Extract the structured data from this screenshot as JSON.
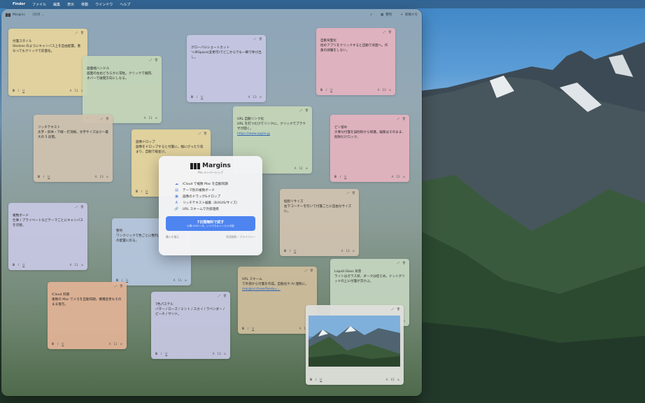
{
  "menubar": {
    "apple": "",
    "app": "Finder",
    "items": [
      "ファイル",
      "編集",
      "表示",
      "移動",
      "ウインドウ",
      "ヘルプ"
    ]
  },
  "window": {
    "brand": "Margins",
    "tag": "1枚目 ⌄",
    "toolbar": {
      "search_icon": "search-icon",
      "view_label": "整列",
      "new_label": "新規メモ"
    }
  },
  "notes": [
    {
      "id": "n1",
      "text": "付箋スタイル\nStickies のようにキャンバス上を自由配置。重なってもクリックで前面化。",
      "count": "11"
    },
    {
      "id": "n2",
      "text": "画面端ハンドル\n画面の左右どちらかに常駐。クリックで展開、ホバーで展開方向にしなる。",
      "count": "11"
    },
    {
      "id": "n3",
      "text": "グローバルショートカット\n⌥⌘Space(変更可)でどこからでも一瞬で呼び出し。",
      "count": "13"
    },
    {
      "id": "n4",
      "text": "自動背面化\n他のアプリをクリックすると自動で背面へ。作業の邪魔をしない。",
      "count": "13"
    },
    {
      "id": "n5",
      "text": "リッチテキスト\n太字・斜体・下線・打消線。文字サイズは小〜最大の 5 段階。",
      "count": "13"
    },
    {
      "id": "n6",
      "text": "URL 自動リンク化\nURL を打つだけでリンクに。クリックでブラウザが開く。",
      "link": "https://www.apple.jp",
      "count": "12"
    },
    {
      "id": "n7",
      "text": "ピン留め\n大事な付箋を誤削除から保護。編集はそのまま、削除だけロック。",
      "count": "12"
    },
    {
      "id": "n8",
      "text": "画像ドロップ\n画像をドロップすると付箋に。幅にぴったり収まり、自動で縦並び。",
      "count": "11"
    },
    {
      "id": "n9",
      "text": "複数ボード\n仕事 / プライベートなどテーマごとにキャンバスを切替。",
      "count": "11"
    },
    {
      "id": "n10",
      "text": "整列\nワンクリックで色ごとに整列。もう一度押すと元の配置に戻る。",
      "count": "11"
    },
    {
      "id": "n11",
      "text": "個別リサイズ\n右下コーナーを引いて付箋ごとに自由なサイズに。",
      "count": "13"
    },
    {
      "id": "n12",
      "text": "iCloud 同期\n複数の Mac でメモを自動同期。機種変更もそのまま復元。",
      "count": "11"
    },
    {
      "id": "n13",
      "text": "7色パステル\nバター / ローズ / ミント / スカイ / ラベンダー / ピーチ / サンド。",
      "count": "13"
    },
    {
      "id": "n14",
      "text": "URL スキーム\n で外部から付箋を作成。自動化や AI 連携に。",
      "link": "margins://new?body=...",
      "count": "13"
    },
    {
      "id": "n15",
      "text": "Liquid Glass 背景\nライトはガラス状、ダークは控えめ。ドットグリッドの上に付箋が浮かぶ。",
      "count": "12"
    },
    {
      "id": "n16",
      "text": "",
      "count": "15"
    }
  ],
  "paywall": {
    "title": "Margins",
    "subtitle": "Pro メンバーシップ",
    "features": [
      {
        "icon": "cloud-icon",
        "label": "iCloud で複数 Mac を自動同期"
      },
      {
        "icon": "boards-icon",
        "label": "テーマ別の複数ボード"
      },
      {
        "icon": "image-icon",
        "label": "画像のドラッグ&ドロップ"
      },
      {
        "icon": "text-format-icon",
        "label": "リッチテキスト編集（B/I/U/S/サイズ）"
      },
      {
        "icon": "link-icon",
        "label": "URL スキームで外部連携"
      }
    ],
    "cta_title": "7日間無料で試す",
    "cta_sub": "以降 ¥100 / 月。いつでもキャンセル可能",
    "restore": "購入を復元",
    "privacy": "利用規約・プライバシー"
  },
  "colors": {
    "accent": "#4d84f0",
    "yellow": "#e6d49c",
    "green": "#c4d6b7",
    "lavender": "#c7c7e3",
    "pink": "#e2b2be"
  }
}
